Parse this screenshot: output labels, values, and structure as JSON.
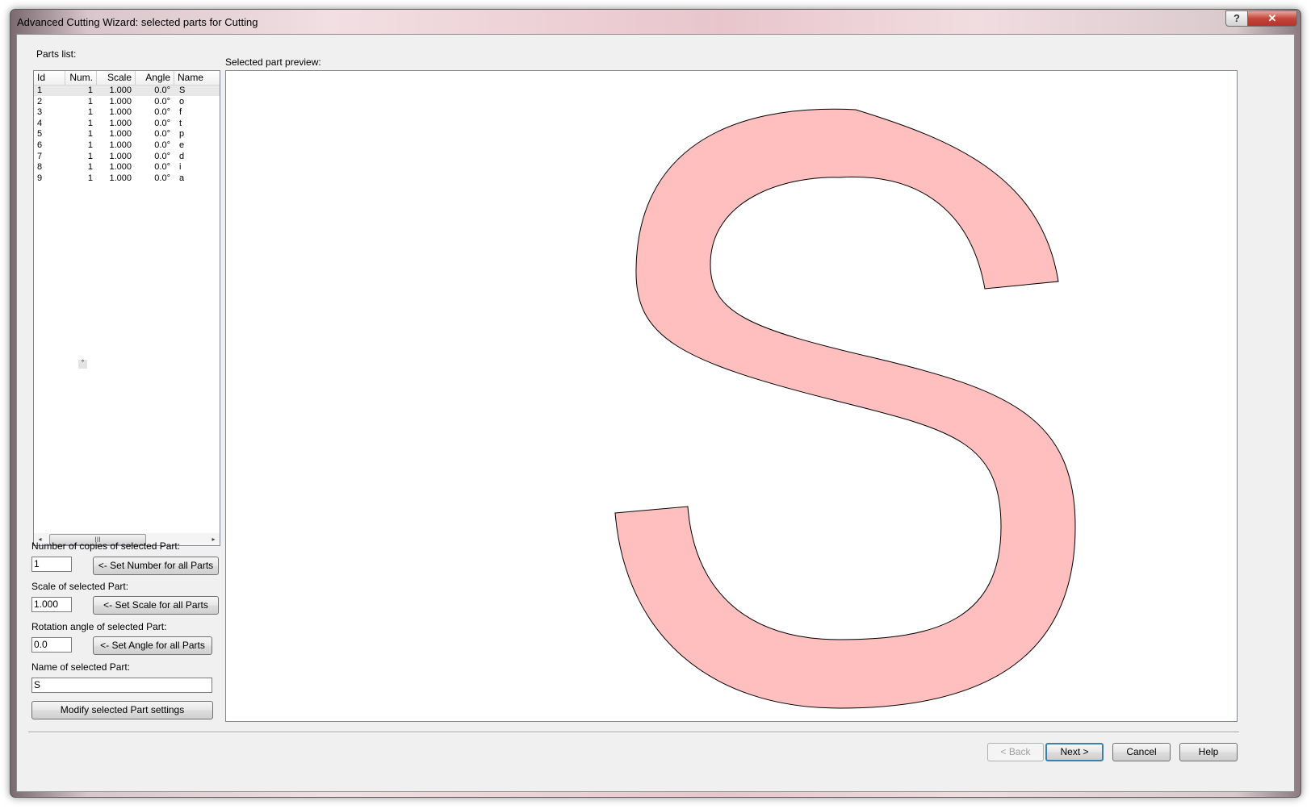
{
  "window": {
    "title": "Advanced Cutting Wizard: selected parts for Cutting",
    "help_glyph": "?",
    "close_glyph": "✕"
  },
  "parts": {
    "label": "Parts list:",
    "columns": [
      "Id",
      "Num.",
      "Scale",
      "Angle",
      "Name"
    ],
    "rows": [
      {
        "id": "1",
        "num": "1",
        "scale": "1.000",
        "angle": "0.0°",
        "name": "S"
      },
      {
        "id": "2",
        "num": "1",
        "scale": "1.000",
        "angle": "0.0°",
        "name": "o"
      },
      {
        "id": "3",
        "num": "1",
        "scale": "1.000",
        "angle": "0.0°",
        "name": "f"
      },
      {
        "id": "4",
        "num": "1",
        "scale": "1.000",
        "angle": "0.0°",
        "name": "t"
      },
      {
        "id": "5",
        "num": "1",
        "scale": "1.000",
        "angle": "0.0°",
        "name": "p"
      },
      {
        "id": "6",
        "num": "1",
        "scale": "1.000",
        "angle": "0.0°",
        "name": "e"
      },
      {
        "id": "7",
        "num": "1",
        "scale": "1.000",
        "angle": "0.0°",
        "name": "d"
      },
      {
        "id": "8",
        "num": "1",
        "scale": "1.000",
        "angle": "0.0°",
        "name": "i"
      },
      {
        "id": "9",
        "num": "1",
        "scale": "1.000",
        "angle": "0.0°",
        "name": "a"
      }
    ],
    "selected_index": 0,
    "scroll_left": "◂",
    "scroll_right": "▸",
    "scroll_grip": "III",
    "stray_glyph": "°"
  },
  "form": {
    "copies_label": "Number of copies of selected Part:",
    "copies_value": "1",
    "copies_button": "<- Set Number for all Parts",
    "scale_label": "Scale of selected Part:",
    "scale_value": "1.000",
    "scale_button": "<- Set Scale for all Parts",
    "angle_label": "Rotation angle of selected Part:",
    "angle_value": "0.0",
    "angle_button": "<- Set Angle for all Parts",
    "name_label": "Name of selected Part:",
    "name_value": "S",
    "modify_button": "Modify selected Part settings"
  },
  "preview": {
    "label": "Selected part preview:",
    "fill_color": "#ffbfbf",
    "stroke_color": "#000000"
  },
  "footer": {
    "back": "< Back",
    "next": "Next >",
    "cancel": "Cancel",
    "help": "Help"
  }
}
